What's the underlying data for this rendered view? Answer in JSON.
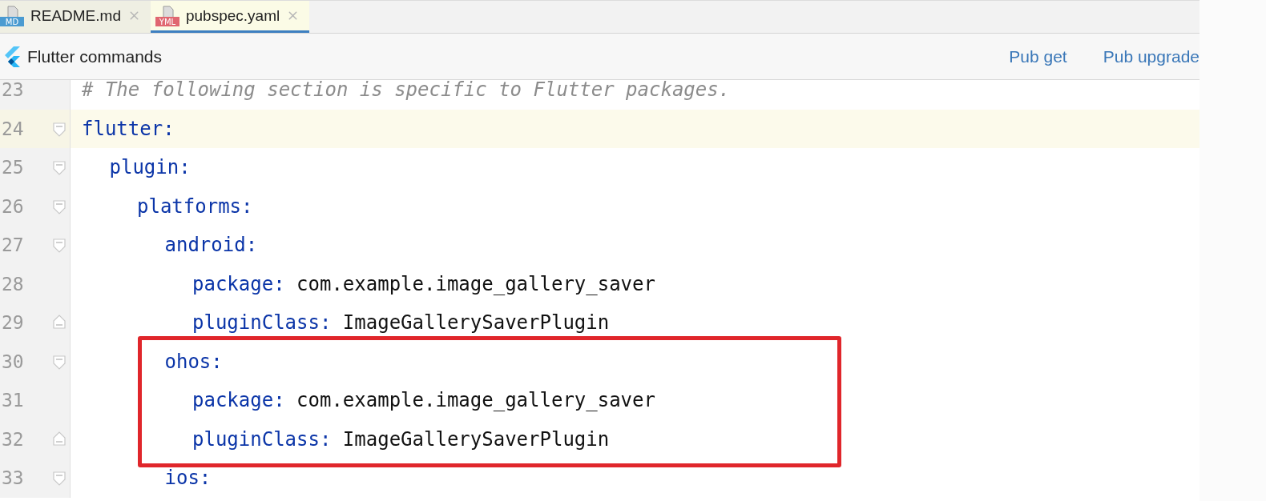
{
  "tabs": [
    {
      "label": "README.md",
      "badge": "MD",
      "kind": "markdown",
      "selected": false
    },
    {
      "label": "pubspec.yaml",
      "badge": "YML",
      "kind": "yaml",
      "selected": true
    }
  ],
  "toolbar": {
    "title": "Flutter commands",
    "actions": [
      "Pub get",
      "Pub upgrade"
    ]
  },
  "editor": {
    "lines": [
      {
        "number": "23",
        "kind": "comment",
        "text": "# The following section is specific to Flutter packages.",
        "fold_start": false,
        "fold_end": false,
        "current": false,
        "marked": false
      },
      {
        "number": "24",
        "kind": "entry",
        "key": "flutter:",
        "fold_start": true,
        "fold_end": false,
        "current": true,
        "marked": false,
        "children": [
          {
            "number": "25",
            "kind": "entry",
            "key": "plugin:",
            "fold_start": true,
            "fold_end": false,
            "current": false,
            "marked": false,
            "children": [
              {
                "number": "26",
                "kind": "entry",
                "key": "platforms:",
                "fold_start": true,
                "fold_end": false,
                "current": false,
                "marked": false,
                "children": [
                  {
                    "number": "27",
                    "kind": "entry",
                    "key": "android:",
                    "fold_start": true,
                    "fold_end": false,
                    "current": false,
                    "marked": false,
                    "children": [
                      {
                        "number": "28",
                        "kind": "entry",
                        "key": "package:",
                        "value": "com.example.image_gallery_saver",
                        "fold_start": false,
                        "fold_end": false,
                        "current": false,
                        "marked": false
                      },
                      {
                        "number": "29",
                        "kind": "entry",
                        "key": "pluginClass:",
                        "value": "ImageGallerySaverPlugin",
                        "fold_start": false,
                        "fold_end": true,
                        "current": false,
                        "marked": false
                      }
                    ]
                  },
                  {
                    "number": "30",
                    "kind": "entry",
                    "key": "ohos:",
                    "fold_start": true,
                    "fold_end": false,
                    "current": false,
                    "marked": true,
                    "children": [
                      {
                        "number": "31",
                        "kind": "entry",
                        "key": "package:",
                        "value": "com.example.image_gallery_saver",
                        "fold_start": false,
                        "fold_end": false,
                        "current": false,
                        "marked": true
                      },
                      {
                        "number": "32",
                        "kind": "entry",
                        "key": "pluginClass:",
                        "value": "ImageGallerySaverPlugin",
                        "fold_start": false,
                        "fold_end": true,
                        "current": false,
                        "marked": true
                      }
                    ]
                  },
                  {
                    "number": "33",
                    "kind": "entry",
                    "key": "ios:",
                    "fold_start": true,
                    "fold_end": false,
                    "current": false,
                    "marked": false
                  }
                ]
              }
            ]
          }
        ]
      }
    ]
  }
}
